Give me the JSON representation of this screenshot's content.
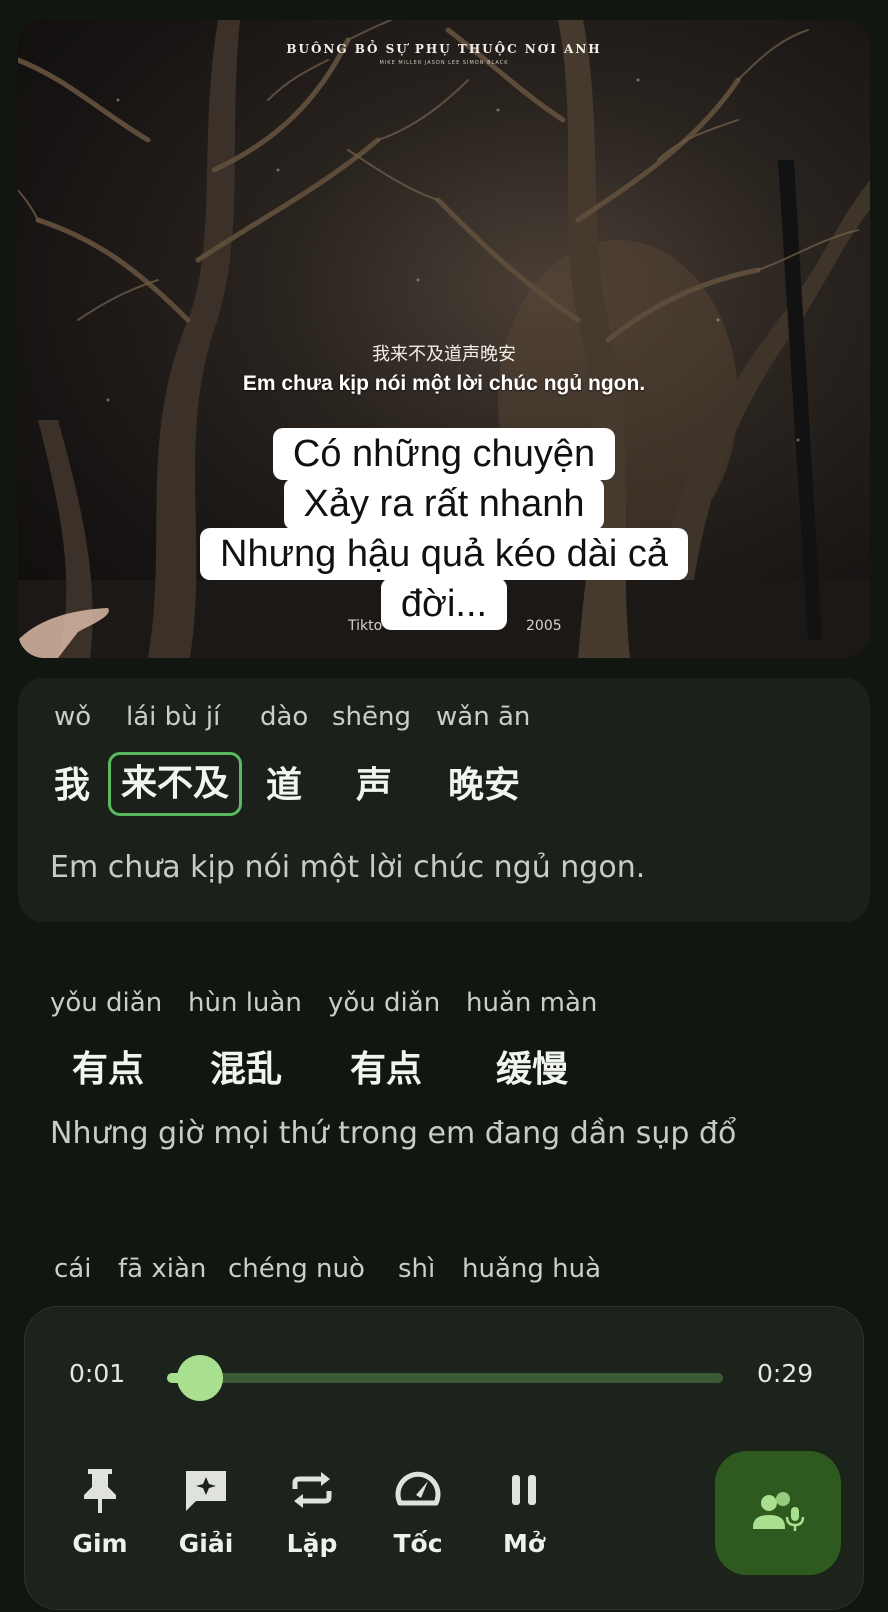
{
  "video": {
    "song_title": "BUÔNG BỎ SỰ PHỤ THUỘC NƠI ANH",
    "song_artists": "MIKE MILLER   JASON LEE   SIMON BLACK",
    "cn_subtitle": "我来不及道声晚安",
    "vi_subtitle": "Em chưa kịp nói một lời chúc ngủ ngon.",
    "watermark_left": "Tikto",
    "watermark_right": "2005",
    "caption_lines": [
      "Có những chuyện",
      "Xảy ra rất nhanh",
      "Nhưng hậu quả kéo dài cả",
      "đời..."
    ]
  },
  "lyrics": [
    {
      "words": [
        {
          "pinyin": "wǒ",
          "hanzi": "我"
        },
        {
          "pinyin": "lái bù jí",
          "hanzi": "来不及"
        },
        {
          "pinyin": "dào",
          "hanzi": "道"
        },
        {
          "pinyin": "shēng",
          "hanzi": "声"
        },
        {
          "pinyin": "wǎn ān",
          "hanzi": "晚安"
        }
      ],
      "translation": "Em chưa kịp nói một lời chúc ngủ ngon."
    },
    {
      "words": [
        {
          "pinyin": "yǒu diǎn",
          "hanzi": "有点"
        },
        {
          "pinyin": "hùn luàn",
          "hanzi": "混乱"
        },
        {
          "pinyin": "yǒu diǎn",
          "hanzi": "有点"
        },
        {
          "pinyin": "huǎn màn",
          "hanzi": "缓慢"
        }
      ],
      "translation": "Nhưng giờ mọi thứ trong em đang dần sụp đổ"
    },
    {
      "words": [
        {
          "pinyin": "cái",
          "hanzi": ""
        },
        {
          "pinyin": "fā xiàn",
          "hanzi": ""
        },
        {
          "pinyin": "chéng nuò",
          "hanzi": ""
        },
        {
          "pinyin": "shì",
          "hanzi": ""
        },
        {
          "pinyin": "huǎng huà",
          "hanzi": ""
        }
      ]
    }
  ],
  "player": {
    "current_time": "0:01",
    "total_time": "0:29",
    "progress": 0.06,
    "controls": [
      {
        "label": "Gim",
        "icon": "pin-icon"
      },
      {
        "label": "Giải",
        "icon": "explain-icon"
      },
      {
        "label": "Lặp",
        "icon": "repeat-icon"
      },
      {
        "label": "Tốc",
        "icon": "speed-icon"
      },
      {
        "label": "Mở",
        "icon": "pause-icon"
      }
    ],
    "fab_icon": "voice-users-icon"
  },
  "colors": {
    "background": "#111611",
    "card": "#1b211a",
    "accent": "#a8e08f",
    "highlight_border": "#5bb85f",
    "fab": "#2f5a1f"
  }
}
